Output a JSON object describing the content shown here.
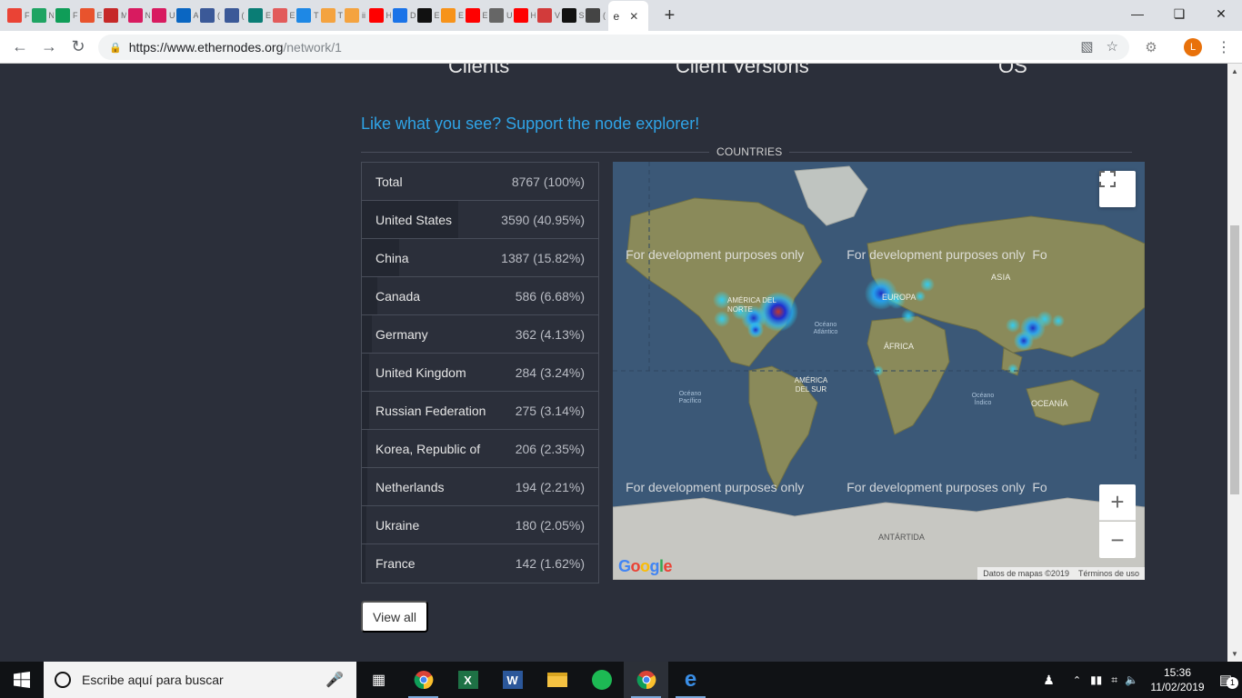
{
  "browser": {
    "tabs": [
      {
        "icon": "gmail-icon",
        "label": "F",
        "color": "#ea4335"
      },
      {
        "icon": "drive-icon",
        "label": "N",
        "color": "#1fa463"
      },
      {
        "icon": "sheets-icon",
        "label": "F",
        "color": "#0f9d58"
      },
      {
        "icon": "ethernodes-icon",
        "label": "E",
        "color": "#e8532d"
      },
      {
        "icon": "meetup-icon",
        "label": "M",
        "color": "#c62828"
      },
      {
        "icon": "m-icon",
        "label": "N",
        "color": "#d81b60"
      },
      {
        "icon": "m-icon",
        "label": "U",
        "color": "#d81b60"
      },
      {
        "icon": "linkedin-icon",
        "label": "A",
        "color": "#0a66c2"
      },
      {
        "icon": "facebook-icon",
        "label": "(",
        "color": "#3b5998"
      },
      {
        "icon": "facebook-icon",
        "label": "(",
        "color": "#3b5998"
      },
      {
        "icon": "bitly-icon",
        "label": "E",
        "color": "#0a7d75"
      },
      {
        "icon": "s-icon",
        "label": "E",
        "color": "#e25b5b"
      },
      {
        "icon": "t-icon",
        "label": "T",
        "color": "#1e88e5"
      },
      {
        "icon": "grid-icon",
        "label": "T",
        "color": "#f4a340"
      },
      {
        "icon": "grid-icon",
        "label": "ii",
        "color": "#f4a340"
      },
      {
        "icon": "youtube-icon",
        "label": "H",
        "color": "#ff0000"
      },
      {
        "icon": "download-icon",
        "label": "D",
        "color": "#1a73e8"
      },
      {
        "icon": "bank-icon",
        "label": "E",
        "color": "#111111"
      },
      {
        "icon": "bitcoin-icon",
        "label": "E",
        "color": "#f7931a"
      },
      {
        "icon": "youtube-icon",
        "label": "E",
        "color": "#ff0000"
      },
      {
        "icon": "audio-icon",
        "label": "U",
        "color": "#666666"
      },
      {
        "icon": "youtube-icon",
        "label": "H",
        "color": "#ff0000"
      },
      {
        "icon": "x-icon",
        "label": "V",
        "color": "#d23b3b"
      },
      {
        "icon": "bank-icon",
        "label": "S",
        "color": "#111111"
      },
      {
        "icon": "b-icon",
        "label": "(",
        "color": "#444444"
      }
    ],
    "active_tab": {
      "label": "e",
      "icon": "ethernodes-icon"
    },
    "url_host": "https://www.ethernodes.org",
    "url_path": "/network/1",
    "profile_initial": "L"
  },
  "page": {
    "headings": [
      "Clients",
      "Client Versions",
      "OS"
    ],
    "support_link": "Like what you see? Support the node explorer!",
    "section_label": "COUNTRIES",
    "countries": [
      {
        "name": "Total",
        "value": "8767 (100%)",
        "share": 0
      },
      {
        "name": "United States",
        "value": "3590 (40.95%)",
        "share": 40.95
      },
      {
        "name": "China",
        "value": "1387 (15.82%)",
        "share": 15.82
      },
      {
        "name": "Canada",
        "value": "586 (6.68%)",
        "share": 6.68
      },
      {
        "name": "Germany",
        "value": "362 (4.13%)",
        "share": 4.13
      },
      {
        "name": "United Kingdom",
        "value": "284 (3.24%)",
        "share": 3.24
      },
      {
        "name": "Russian Federation",
        "value": "275 (3.14%)",
        "share": 3.14
      },
      {
        "name": "Korea, Republic of",
        "value": "206 (2.35%)",
        "share": 2.35
      },
      {
        "name": "Netherlands",
        "value": "194 (2.21%)",
        "share": 2.21
      },
      {
        "name": "Ukraine",
        "value": "180 (2.05%)",
        "share": 2.05
      },
      {
        "name": "France",
        "value": "142 (1.62%)",
        "share": 1.62
      }
    ],
    "view_all": "View all",
    "map": {
      "watermark": "For development purposes only",
      "labels": {
        "asia": "ASIA",
        "europa": "EUROPA",
        "north_america": "AMÉRICA DEL NORTE",
        "south_america": "AMÉRICA DEL SUR",
        "africa": "ÁFRICA",
        "oceania": "OCEANÍA",
        "antarctica": "ANTÁRTIDA",
        "atlantic": "Océano Atlántico",
        "pacific": "Océano Pacífico",
        "indian": "Océano Índico"
      },
      "attribution": "Datos de mapas ©2019",
      "terms": "Términos de uso",
      "zoom_in": "+",
      "zoom_out": "−",
      "logo": "Google"
    }
  },
  "taskbar": {
    "search_placeholder": "Escribe aquí para buscar",
    "time": "15:36",
    "date": "11/02/2019",
    "notifications": "1"
  }
}
